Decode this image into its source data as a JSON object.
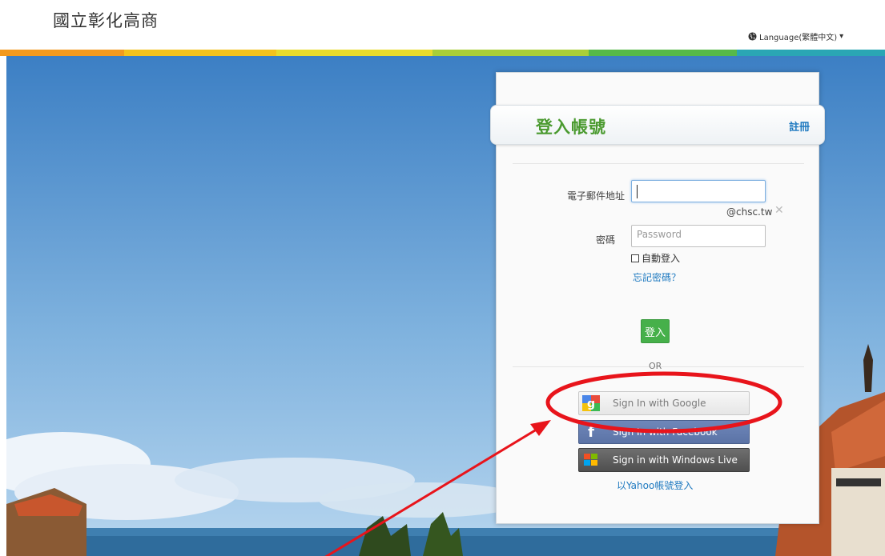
{
  "site": {
    "title": "國立彰化高商",
    "language_label": "Language(繁體中文)"
  },
  "stripe_colors": [
    "#f39a1e",
    "#f5c21b",
    "#e9dc2c",
    "#a9cf38",
    "#56b949",
    "#2aa6b4"
  ],
  "login": {
    "title": "登入帳號",
    "register_label": "註冊",
    "email_label": "電子郵件地址",
    "email_value": "",
    "email_domain": "@chsc.tw",
    "password_label": "密碼",
    "password_placeholder": "Password",
    "remember_label": "自動登入",
    "forgot_label": "忘記密碼？",
    "submit_label": "登入",
    "or_label": "OR",
    "google_label": "Sign In with Google",
    "facebook_label": "Sign In with Facebook",
    "windows_label": "Sign in with Windows Live",
    "yahoo_label": "以Yahoo帳號登入"
  },
  "annotation": {
    "color": "#e8141b"
  }
}
